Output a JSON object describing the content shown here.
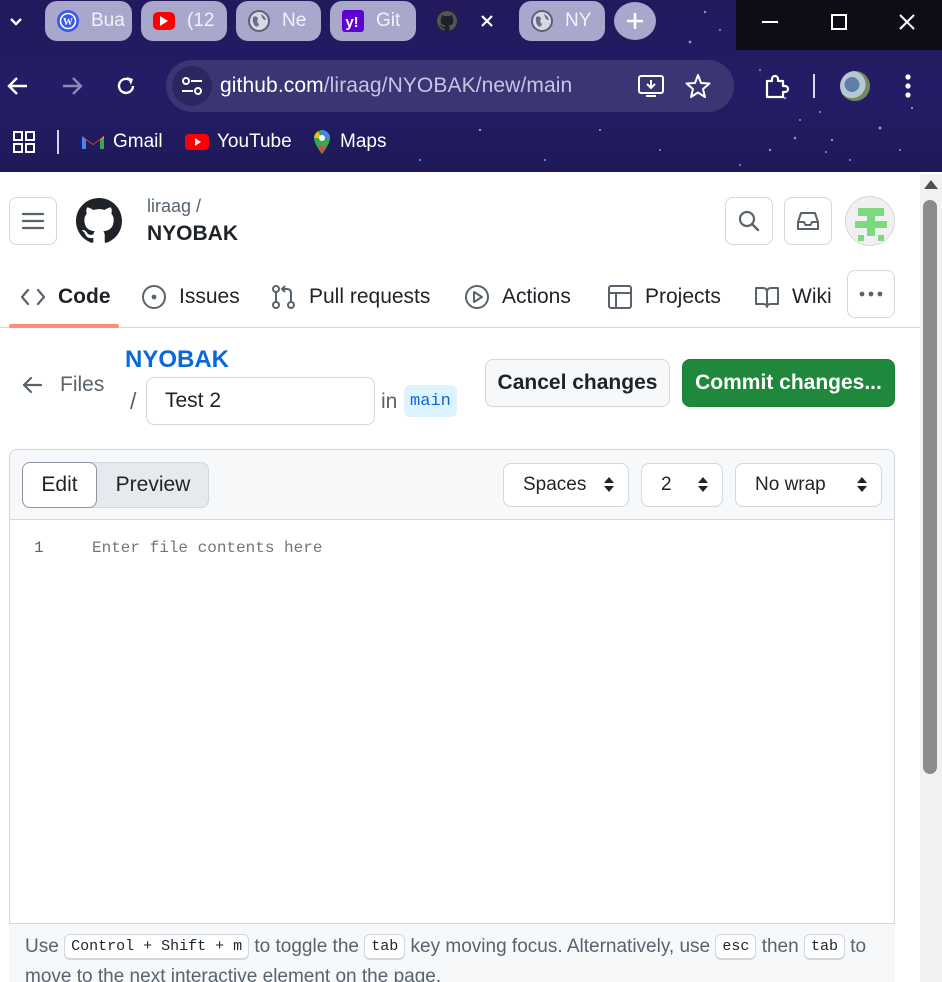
{
  "browser": {
    "tabs": [
      {
        "title": "Bua",
        "favicon": "wordpress-icon"
      },
      {
        "title": "(12",
        "favicon": "youtube-icon"
      },
      {
        "title": "Ne",
        "favicon": "globe-icon"
      },
      {
        "title": "Git",
        "favicon": "yahoo-icon"
      },
      {
        "title": "",
        "favicon": "github-icon"
      },
      {
        "title": "NY",
        "favicon": "globe-icon"
      }
    ],
    "url_host": "github.com",
    "url_path": "/liraag/NYOBAK/new/main",
    "bookmarks": [
      {
        "label": "Gmail",
        "icon": "gmail-icon"
      },
      {
        "label": "YouTube",
        "icon": "youtube-icon"
      },
      {
        "label": "Maps",
        "icon": "maps-icon"
      }
    ],
    "colors": {
      "frame": "#221a5c",
      "tab": "#a9a7cc",
      "omnibox": "#3a3573"
    }
  },
  "github": {
    "owner": "liraag /",
    "repo": "NYOBAK",
    "nav": [
      {
        "label": "Code",
        "icon": "code-icon",
        "selected": true
      },
      {
        "label": "Issues",
        "icon": "issue-opened-icon"
      },
      {
        "label": "Pull requests",
        "icon": "git-pull-request-icon"
      },
      {
        "label": "Actions",
        "icon": "play-icon"
      },
      {
        "label": "Projects",
        "icon": "table-icon"
      },
      {
        "label": "Wiki",
        "icon": "book-icon"
      }
    ],
    "colors": {
      "accent_underline": "#fd8c73",
      "link": "#0969da",
      "commit_green": "#1f883d"
    }
  },
  "editor_page": {
    "files_label": "Files",
    "repo_link": "NYOBAK",
    "slash": "/",
    "filename_value": "Test 2",
    "in_label": "in",
    "branch": "main",
    "cancel_label": "Cancel changes",
    "commit_label": "Commit changes...",
    "tab_edit": "Edit",
    "tab_preview": "Preview",
    "indent_mode": "Spaces",
    "indent_size": "2",
    "wrap_mode": "No wrap",
    "line_number": "1",
    "placeholder": "Enter file contents here",
    "hint": {
      "p1": "Use ",
      "k1": "Control + Shift + m",
      "p2": " to toggle the ",
      "k2": "tab",
      "p3": " key moving focus. Alternatively, use ",
      "k3": "esc",
      "p4": " then ",
      "k4": "tab",
      "p5": " to move to the next interactive element on the page."
    }
  }
}
